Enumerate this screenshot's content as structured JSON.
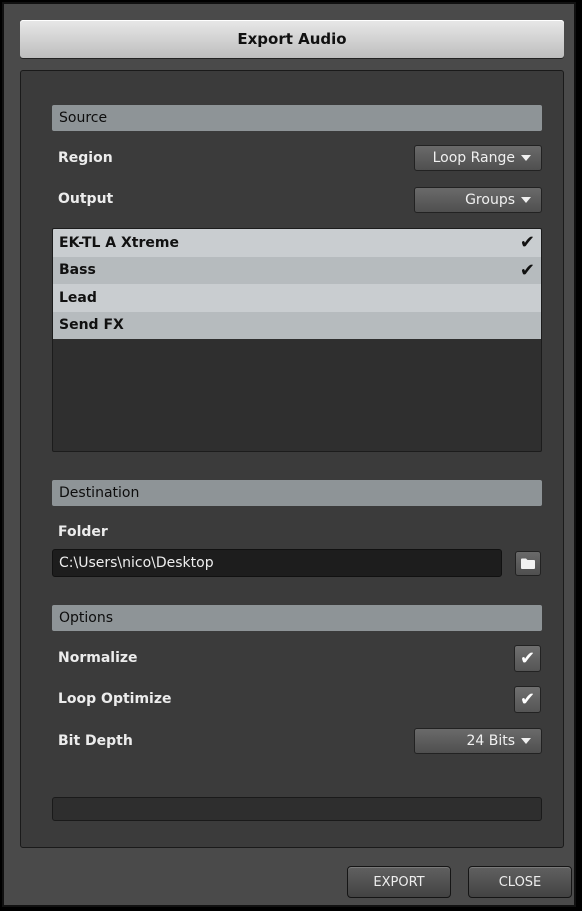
{
  "window": {
    "title": "Export Audio"
  },
  "source": {
    "header": "Source",
    "region_label": "Region",
    "region_value": "Loop Range",
    "output_label": "Output",
    "output_value": "Groups",
    "items": [
      {
        "label": "EK-TL A Xtreme",
        "checked": true,
        "check": "✔"
      },
      {
        "label": "Bass",
        "checked": true,
        "check": "✔"
      },
      {
        "label": "Lead",
        "checked": false,
        "check": ""
      },
      {
        "label": "Send FX",
        "checked": false,
        "check": ""
      }
    ]
  },
  "destination": {
    "header": "Destination",
    "folder_label": "Folder",
    "folder_value": "C:\\Users\\nico\\Desktop",
    "browse_icon": "folder-icon"
  },
  "options": {
    "header": "Options",
    "normalize_label": "Normalize",
    "normalize_checked": true,
    "loop_optimize_label": "Loop Optimize",
    "loop_optimize_checked": true,
    "bit_depth_label": "Bit Depth",
    "bit_depth_value": "24 Bits",
    "check_glyph": "✔"
  },
  "progress": {
    "fraction": 0
  },
  "buttons": {
    "export": "EXPORT",
    "close": "CLOSE"
  }
}
